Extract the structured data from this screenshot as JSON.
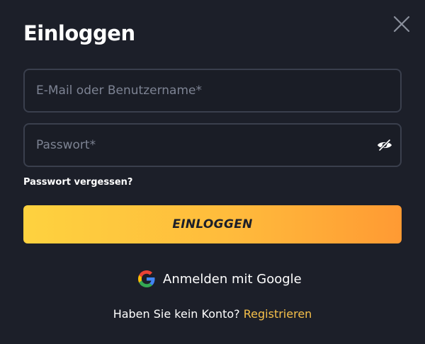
{
  "modal": {
    "title": "Einloggen",
    "close_icon": "close-icon"
  },
  "form": {
    "email_placeholder": "E-Mail oder Benutzername*",
    "email_value": "",
    "password_placeholder": "Passwort*",
    "password_value": "",
    "password_toggle_icon": "eye-slash-icon",
    "forgot_label": "Passwort vergessen?",
    "submit_label": "EINLOGGEN"
  },
  "social": {
    "google_label": "Anmelden mit Google",
    "google_icon": "google-icon"
  },
  "signup": {
    "prompt": "Haben Sie kein Konto?",
    "link_label": "Registrieren"
  },
  "colors": {
    "background": "#1c1f29",
    "accent": "#f6c04a",
    "button_gradient_start": "#fed23f",
    "button_gradient_end": "#ff9a33",
    "field_border": "#3a3f4d"
  }
}
